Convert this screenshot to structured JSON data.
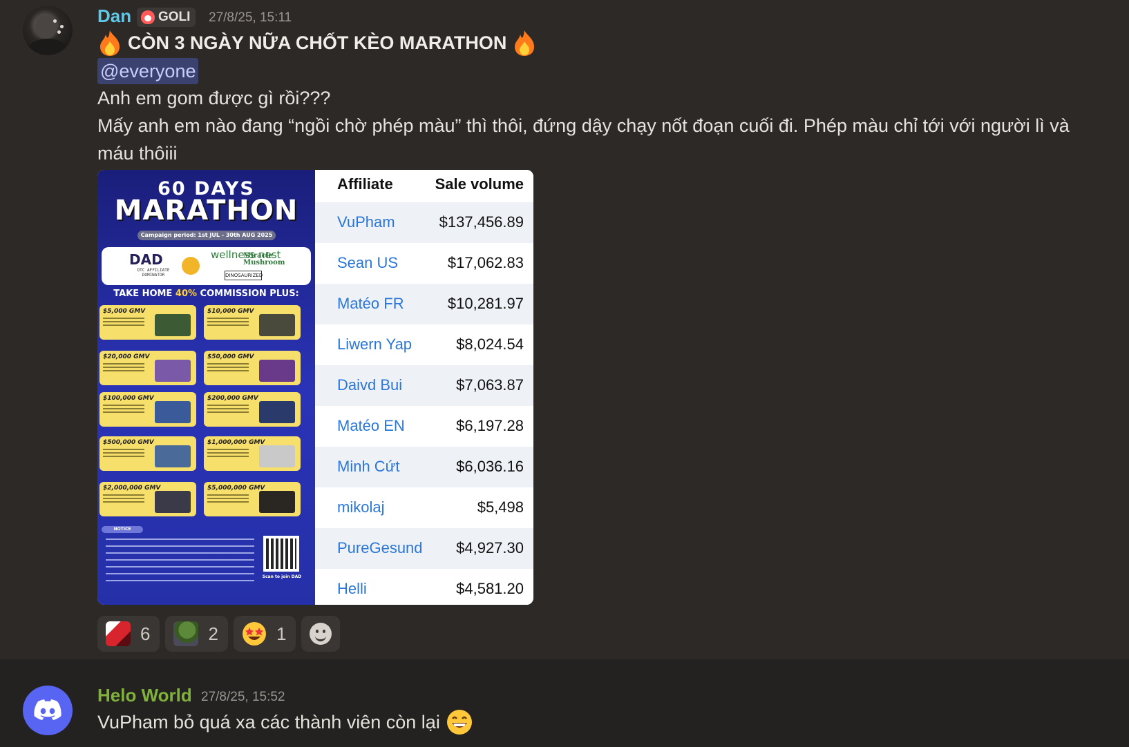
{
  "colors": {
    "mention_bg": "#3c4270",
    "author1": "#5fc8e8",
    "author2": "#7fb23a",
    "link": "#2a77d8"
  },
  "message1": {
    "author": "Dan",
    "server_tag": "GOLI",
    "timestamp": "27/8/25, 15:11",
    "headline": "CÒN 3 NGÀY NỮA CHỐT KÈO MARATHON",
    "mention": "@everyone",
    "line1": "Anh em gom được gì rồi???",
    "line2": "Mấy anh em nào đang “ngồi chờ phép màu” thì thôi, đứng dậy chạy nốt đoạn cuối đi. Phép màu chỉ tới với người lì và",
    "line3": "máu thôiii",
    "poster": {
      "title1": "60 DAYS",
      "title2": "MARATHON",
      "period": "Campaign period: 1st JUL - 30th AUG 2025",
      "brand_dad": "DAD",
      "brand_dad_sub": "DTC AFFILIATE DOMINATOR",
      "brand_wellness": "wellness nest",
      "brand_mushroom": "Miracle Mushroom",
      "brand_dino": "DINOSAURIZED",
      "take_home_a": "TAKE HOME ",
      "take_home_pct": "40%",
      "take_home_b": " COMMISSION PLUS:",
      "cards": [
        "$5,000 GMV",
        "$10,000 GMV",
        "$20,000 GMV",
        "$50,000 GMV",
        "$100,000 GMV",
        "$200,000 GMV",
        "$500,000 GMV",
        "$1,000,000 GMV",
        "$2,000,000 GMV",
        "$5,000,000 GMV"
      ],
      "notice": "NOTICE",
      "scan": "Scan to join DAD"
    },
    "table": {
      "col1": "Affiliate",
      "col2": "Sale volume",
      "rows": [
        {
          "name": "VuPham",
          "value": "$137,456.89"
        },
        {
          "name": "Sean US",
          "value": "$17,062.83"
        },
        {
          "name": "Matéo FR",
          "value": "$10,281.97"
        },
        {
          "name": "Liwern Yap",
          "value": "$8,024.54"
        },
        {
          "name": "Daivd Bui",
          "value": "$7,063.87"
        },
        {
          "name": "Matéo EN",
          "value": "$6,197.28"
        },
        {
          "name": "Minh Cứt",
          "value": "$6,036.16"
        },
        {
          "name": "mikolaj",
          "value": "$5,498"
        },
        {
          "name": "PureGesund",
          "value": "$4,927.30"
        },
        {
          "name": "Helli",
          "value": "$4,581.20"
        }
      ]
    },
    "reactions": [
      {
        "icon": "custom-photo-emoji-icon",
        "count": "6"
      },
      {
        "icon": "pepe-frog-emoji-icon",
        "count": "2"
      },
      {
        "icon": "star-struck-emoji-icon",
        "count": "1"
      }
    ]
  },
  "message2": {
    "author": "Helo World",
    "timestamp": "27/8/25, 15:52",
    "text": "VuPham bỏ quá xa các thành viên còn lại"
  }
}
